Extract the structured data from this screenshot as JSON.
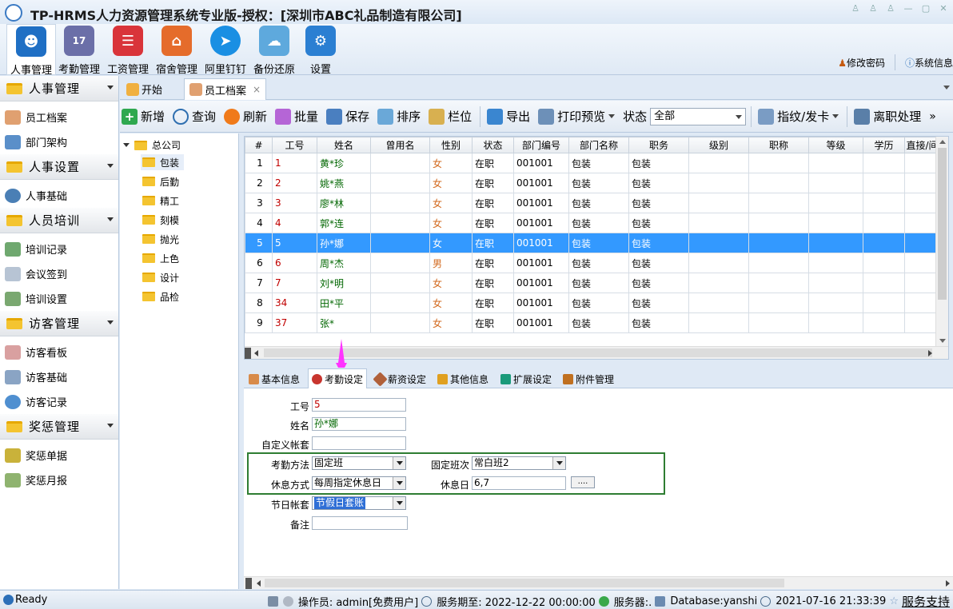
{
  "window": {
    "title": "TP-HRMS人力资源管理系统专业版-授权：[深圳市ABC礼品制造有限公司]"
  },
  "ribbon": {
    "items": [
      {
        "label": "人事管理",
        "icon": "people-icon",
        "color": "#1f6fc4"
      },
      {
        "label": "考勤管理",
        "icon": "calendar-icon",
        "color": "#6b6fa8"
      },
      {
        "label": "工资管理",
        "icon": "payroll-icon",
        "color": "#d9343a"
      },
      {
        "label": "宿舍管理",
        "icon": "house-gear-icon",
        "color": "#e56c2b"
      },
      {
        "label": "阿里钉钉",
        "icon": "dingtalk-icon",
        "color": "#1a8fe3"
      },
      {
        "label": "备份还原",
        "icon": "cloud-icon",
        "color": "#5ea9dd"
      },
      {
        "label": "设置",
        "icon": "gear-icon",
        "color": "#2b7fd2"
      }
    ],
    "change_password": "修改密码",
    "system_info": "系统信息"
  },
  "sidebar": {
    "groups": [
      {
        "title": "人事管理",
        "items": [
          "员工档案",
          "部门架构"
        ]
      },
      {
        "title": "人事设置",
        "items": [
          "人事基础"
        ]
      },
      {
        "title": "人员培训",
        "items": [
          "培训记录",
          "会议签到",
          "培训设置"
        ]
      },
      {
        "title": "访客管理",
        "items": [
          "访客看板",
          "访客基础",
          "访客记录"
        ]
      },
      {
        "title": "奖惩管理",
        "items": [
          "奖惩单据",
          "奖惩月报"
        ]
      }
    ]
  },
  "doc_tabs": {
    "home": "开始",
    "active": "员工档案",
    "close": "×"
  },
  "toolbar": {
    "new": "新增",
    "query": "查询",
    "refresh": "刷新",
    "batch": "批量",
    "save": "保存",
    "sort": "排序",
    "columns": "栏位",
    "export": "导出",
    "print_preview": "打印预览",
    "status_label": "状态",
    "status_value": "全部",
    "fingerprint": "指纹/发卡",
    "resign": "离职处理",
    "more": "»"
  },
  "tree": {
    "root": "总公司",
    "nodes": [
      "包装",
      "后勤",
      "精工",
      "刻模",
      "抛光",
      "上色",
      "设计",
      "品检"
    ]
  },
  "grid": {
    "columns": [
      "#",
      "工号",
      "姓名",
      "曾用名",
      "性别",
      "状态",
      "部门编号",
      "部门名称",
      "职务",
      "级别",
      "职称",
      "等级",
      "学历",
      "直接/间"
    ],
    "rows": [
      {
        "idx": "1",
        "id": "1",
        "name": "黄*珍",
        "alias": "",
        "sex": "女",
        "status": "在职",
        "dept_no": "001001",
        "dept": "包装",
        "post": "包装"
      },
      {
        "idx": "2",
        "id": "2",
        "name": "姚*燕",
        "alias": "",
        "sex": "女",
        "status": "在职",
        "dept_no": "001001",
        "dept": "包装",
        "post": "包装"
      },
      {
        "idx": "3",
        "id": "3",
        "name": "廖*林",
        "alias": "",
        "sex": "女",
        "status": "在职",
        "dept_no": "001001",
        "dept": "包装",
        "post": "包装"
      },
      {
        "idx": "4",
        "id": "4",
        "name": "郭*连",
        "alias": "",
        "sex": "女",
        "status": "在职",
        "dept_no": "001001",
        "dept": "包装",
        "post": "包装"
      },
      {
        "idx": "5",
        "id": "5",
        "name": "孙*娜",
        "alias": "",
        "sex": "女",
        "status": "在职",
        "dept_no": "001001",
        "dept": "包装",
        "post": "包装"
      },
      {
        "idx": "6",
        "id": "6",
        "name": "周*杰",
        "alias": "",
        "sex": "男",
        "status": "在职",
        "dept_no": "001001",
        "dept": "包装",
        "post": "包装"
      },
      {
        "idx": "7",
        "id": "7",
        "name": "刘*明",
        "alias": "",
        "sex": "女",
        "status": "在职",
        "dept_no": "001001",
        "dept": "包装",
        "post": "包装"
      },
      {
        "idx": "8",
        "id": "34",
        "name": "田*平",
        "alias": "",
        "sex": "女",
        "status": "在职",
        "dept_no": "001001",
        "dept": "包装",
        "post": "包装"
      },
      {
        "idx": "9",
        "id": "37",
        "name": "张*",
        "alias": "",
        "sex": "女",
        "status": "在职",
        "dept_no": "001001",
        "dept": "包装",
        "post": "包装"
      }
    ],
    "selected_index": 4
  },
  "detail_tabs": [
    "基本信息",
    "考勤设定",
    "薪资设定",
    "其他信息",
    "扩展设定",
    "附件管理"
  ],
  "form": {
    "emp_no_label": "工号",
    "emp_no": "5",
    "name_label": "姓名",
    "name": "孙*娜",
    "custom_account_label": "自定义帐套",
    "custom_account": "",
    "attend_method_label": "考勤方法",
    "attend_method": "固定班",
    "fixed_shift_label": "固定班次",
    "fixed_shift": "常白班2",
    "rest_mode_label": "休息方式",
    "rest_mode": "每周指定休息日",
    "rest_day_label": "休息日",
    "rest_day": "6,7",
    "ellipsis": "....",
    "holiday_account_label": "节日帐套",
    "holiday_account": "节假日套账",
    "remark_label": "备注",
    "remark": ""
  },
  "status": {
    "ready": "Ready",
    "operator": "操作员: admin[免费用户]",
    "expire": "服务期至: 2022-12-22 00:00:00",
    "server": "服务器:.",
    "database": "Database:yanshi",
    "datetime": "2021-07-16 21:33:39",
    "support": "服务支持"
  }
}
